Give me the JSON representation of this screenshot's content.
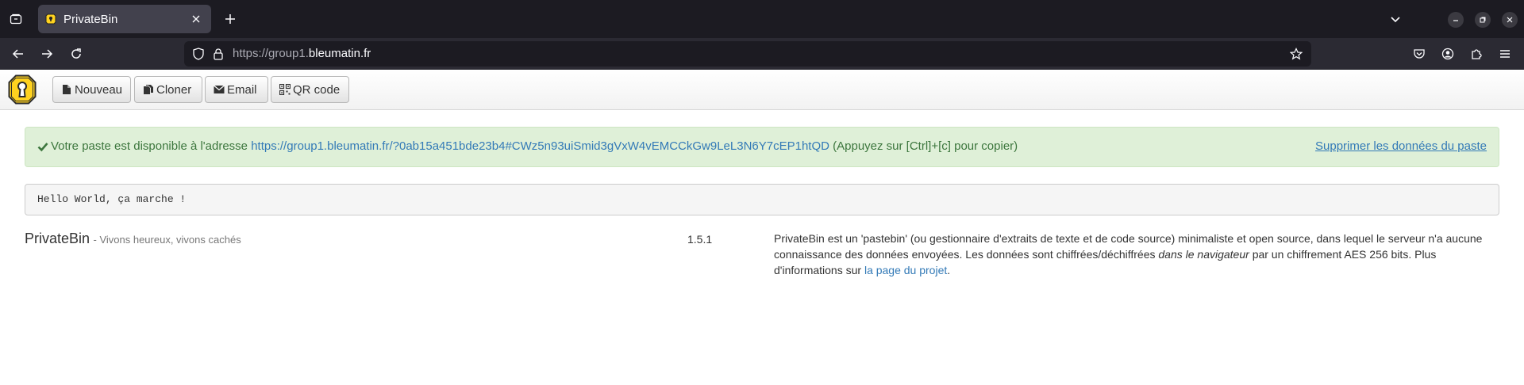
{
  "browser": {
    "tab_title": "PrivateBin",
    "url_prefix": "https://group1.",
    "url_domain": "bleumatin.fr"
  },
  "toolbar": {
    "new_label": "Nouveau",
    "clone_label": "Cloner",
    "email_label": "Email",
    "qr_label": "QR code"
  },
  "alert": {
    "prefix": "Votre paste est disponible à l'adresse",
    "link": "https://group1.bleumatin.fr/?0ab15a451bde23b4#CWz5n93uiSmid3gVxW4vEMCCkGw9LeL3N6Y7cEP1htQD",
    "suffix": "(Appuyez sur [Ctrl]+[c] pour copier)",
    "delete_label": "Supprimer les données du paste"
  },
  "paste": {
    "content": "Hello World, ça marche !"
  },
  "footer": {
    "name": "PrivateBin",
    "tagline": "- Vivons heureux, vivons cachés",
    "version": "1.5.1",
    "about_part1": "PrivateBin est un 'pastebin' (ou gestionnaire d'extraits de texte et de code source) minimaliste et open source, dans lequel le serveur n'a aucune connaissance des données envoyées. Les données sont chiffrées/déchiffrées",
    "about_emph": "dans le navigateur",
    "about_part2": "par un chiffrement AES 256 bits. Plus d'informations sur",
    "about_link": "la page du projet",
    "about_end": "."
  },
  "colors": {
    "alert_bg": "#dff0d8",
    "alert_text": "#3c763d",
    "link": "#337ab7",
    "logo_yellow": "#ffd21f"
  },
  "icons": [
    "tab-list-icon",
    "privatebin-favicon-icon",
    "close-icon",
    "plus-icon",
    "chevron-down-icon",
    "minimize-icon",
    "maximize-icon",
    "window-close-icon",
    "back-icon",
    "forward-icon",
    "reload-icon",
    "shield-icon",
    "lock-icon",
    "star-icon",
    "pocket-icon",
    "account-icon",
    "extensions-icon",
    "menu-icon",
    "file-icon",
    "copy-icon",
    "envelope-icon",
    "qrcode-icon",
    "check-icon"
  ]
}
